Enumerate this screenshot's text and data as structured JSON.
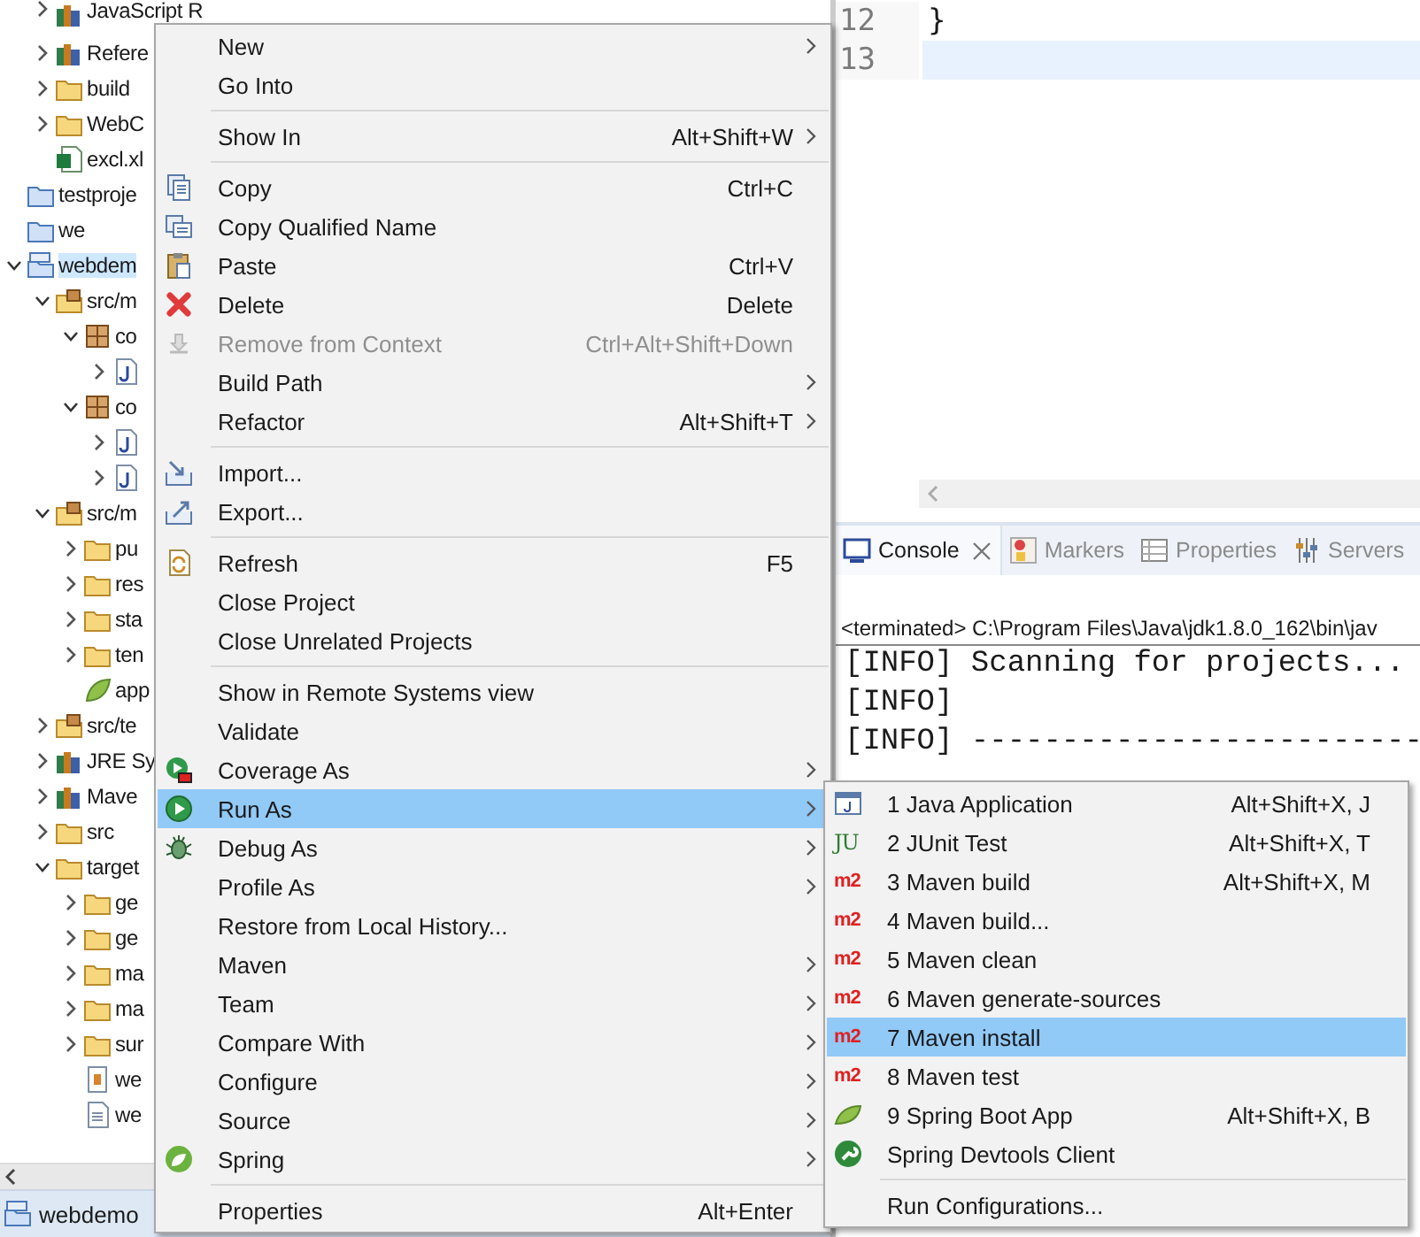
{
  "project_explorer": {
    "continued_items": [
      {
        "label": "JavaScript R",
        "kind": "library",
        "expanded": false,
        "selected": false
      },
      {
        "label": "Refere",
        "kind": "library",
        "expanded": false,
        "selected": false
      },
      {
        "label": "build",
        "kind": "folder",
        "expanded": false,
        "selected": false
      },
      {
        "label": "WebC",
        "kind": "folder",
        "expanded": false,
        "selected": false
      },
      {
        "label": "excl.xl",
        "kind": "excel",
        "selected": false
      }
    ],
    "items": [
      {
        "label": "testproje",
        "kind": "project",
        "selected": false
      },
      {
        "label": "we",
        "kind": "project",
        "selected": false
      },
      {
        "label": "webdem",
        "kind": "maven-project",
        "expanded": true,
        "selected": true,
        "children": [
          {
            "label": "src/m",
            "kind": "source-folder",
            "expanded": true,
            "selected": false,
            "children": [
              {
                "label": "co",
                "kind": "package",
                "expanded": true,
                "selected": false,
                "children": [
                  {
                    "kind": "java-file",
                    "expanded": false,
                    "selected": false
                  }
                ]
              },
              {
                "label": "co",
                "kind": "package",
                "expanded": true,
                "selected": false,
                "children": [
                  {
                    "kind": "java-file",
                    "expanded": false,
                    "selected": false
                  },
                  {
                    "kind": "java-file",
                    "expanded": false,
                    "selected": false
                  }
                ]
              }
            ]
          },
          {
            "label": "src/m",
            "kind": "source-folder",
            "expanded": true,
            "selected": false,
            "children": [
              {
                "label": "pu",
                "kind": "folder",
                "expanded": false,
                "selected": false
              },
              {
                "label": "res",
                "kind": "folder",
                "expanded": false,
                "selected": false
              },
              {
                "label": "sta",
                "kind": "folder",
                "expanded": false,
                "selected": false
              },
              {
                "label": "ten",
                "kind": "folder",
                "expanded": false,
                "selected": false
              },
              {
                "label": "app",
                "kind": "leaf-file",
                "selected": false
              }
            ]
          },
          {
            "label": "src/te",
            "kind": "source-folder",
            "expanded": false,
            "selected": false
          },
          {
            "label": "JRE Sy",
            "kind": "library",
            "expanded": false,
            "selected": false
          },
          {
            "label": "Mave",
            "kind": "library",
            "expanded": false,
            "selected": false
          },
          {
            "label": "src",
            "kind": "folder",
            "expanded": false,
            "selected": false
          },
          {
            "label": "target",
            "kind": "folder",
            "expanded": true,
            "selected": false,
            "children": [
              {
                "label": "ge",
                "kind": "folder",
                "expanded": false,
                "selected": false
              },
              {
                "label": "ge",
                "kind": "folder",
                "expanded": false,
                "selected": false
              },
              {
                "label": "ma",
                "kind": "folder",
                "expanded": false,
                "selected": false
              },
              {
                "label": "ma",
                "kind": "folder",
                "expanded": false,
                "selected": false
              },
              {
                "label": "sur",
                "kind": "folder",
                "expanded": false,
                "selected": false
              },
              {
                "label": "we",
                "kind": "archive-file",
                "selected": false
              },
              {
                "label": "we",
                "kind": "text-file",
                "selected": false
              }
            ]
          }
        ]
      }
    ]
  },
  "status_bar": {
    "project": "webdemo"
  },
  "editor": {
    "lines": [
      {
        "number": "12",
        "code": "}",
        "current": false
      },
      {
        "number": "13",
        "current": true
      }
    ]
  },
  "console": {
    "tabs": [
      {
        "label": "Console",
        "kind": "console",
        "selected": true,
        "closable": true
      },
      {
        "label": "Markers",
        "kind": "markers",
        "selected": false,
        "closable": false
      },
      {
        "label": "Properties",
        "kind": "properties",
        "selected": false,
        "closable": false
      },
      {
        "label": "Servers",
        "kind": "servers",
        "selected": false,
        "closable": false
      }
    ],
    "header": "<terminated> C:\\Program Files\\Java\\jdk1.8.0_162\\bin\\jav",
    "lines": [
      "[INFO] Scanning for projects...",
      "[INFO]",
      "[INFO] -------------------------"
    ]
  },
  "context_menu": {
    "items": [
      {
        "kind": "plain",
        "label": "New",
        "submenu": true,
        "selected": false,
        "disabled": false
      },
      {
        "kind": "plain",
        "label": "Go Into",
        "submenu": false,
        "selected": false,
        "disabled": false
      },
      {
        "kind": "separator"
      },
      {
        "kind": "plain",
        "label": "Show In",
        "shortcut": "Alt+Shift+W",
        "submenu": true,
        "selected": false,
        "disabled": false
      },
      {
        "kind": "separator"
      },
      {
        "kind": "copy",
        "label": "Copy",
        "shortcut": "Ctrl+C",
        "submenu": false,
        "selected": false,
        "disabled": false
      },
      {
        "kind": "copy-name",
        "label": "Copy Qualified Name",
        "submenu": false,
        "selected": false,
        "disabled": false
      },
      {
        "kind": "paste",
        "label": "Paste",
        "shortcut": "Ctrl+V",
        "submenu": false,
        "selected": false,
        "disabled": false
      },
      {
        "kind": "delete",
        "label": "Delete",
        "shortcut": "Delete",
        "submenu": false,
        "selected": false,
        "disabled": false
      },
      {
        "kind": "remove",
        "label": "Remove from Context",
        "shortcut": "Ctrl+Alt+Shift+Down",
        "submenu": false,
        "selected": false,
        "disabled": true
      },
      {
        "kind": "plain",
        "label": "Build Path",
        "submenu": true,
        "selected": false,
        "disabled": false
      },
      {
        "kind": "plain",
        "label": "Refactor",
        "shortcut": "Alt+Shift+T",
        "submenu": true,
        "selected": false,
        "disabled": false
      },
      {
        "kind": "separator"
      },
      {
        "kind": "import",
        "label": "Import...",
        "submenu": false,
        "selected": false,
        "disabled": false
      },
      {
        "kind": "export",
        "label": "Export...",
        "submenu": false,
        "selected": false,
        "disabled": false
      },
      {
        "kind": "separator"
      },
      {
        "kind": "refresh",
        "label": "Refresh",
        "shortcut": "F5",
        "submenu": false,
        "selected": false,
        "disabled": false
      },
      {
        "kind": "plain",
        "label": "Close Project",
        "submenu": false,
        "selected": false,
        "disabled": false
      },
      {
        "kind": "plain",
        "label": "Close Unrelated Projects",
        "submenu": false,
        "selected": false,
        "disabled": false
      },
      {
        "kind": "separator"
      },
      {
        "kind": "plain",
        "label": "Show in Remote Systems view",
        "submenu": false,
        "selected": false,
        "disabled": false
      },
      {
        "kind": "plain",
        "label": "Validate",
        "submenu": false,
        "selected": false,
        "disabled": false
      },
      {
        "kind": "coverage",
        "label": "Coverage As",
        "submenu": true,
        "selected": false,
        "disabled": false
      },
      {
        "kind": "run",
        "label": "Run As",
        "submenu": true,
        "selected": true,
        "disabled": false
      },
      {
        "kind": "debug",
        "label": "Debug As",
        "submenu": true,
        "selected": false,
        "disabled": false
      },
      {
        "kind": "plain",
        "label": "Profile As",
        "submenu": true,
        "selected": false,
        "disabled": false
      },
      {
        "kind": "plain",
        "label": "Restore from Local History...",
        "submenu": false,
        "selected": false,
        "disabled": false
      },
      {
        "kind": "plain",
        "label": "Maven",
        "submenu": true,
        "selected": false,
        "disabled": false
      },
      {
        "kind": "plain",
        "label": "Team",
        "submenu": true,
        "selected": false,
        "disabled": false
      },
      {
        "kind": "plain",
        "label": "Compare With",
        "submenu": true,
        "selected": false,
        "disabled": false
      },
      {
        "kind": "plain",
        "label": "Configure",
        "submenu": true,
        "selected": false,
        "disabled": false
      },
      {
        "kind": "plain",
        "label": "Source",
        "submenu": true,
        "selected": false,
        "disabled": false
      },
      {
        "kind": "spring",
        "label": "Spring",
        "submenu": true,
        "selected": false,
        "disabled": false
      },
      {
        "kind": "separator"
      },
      {
        "kind": "plain",
        "label": "Properties",
        "shortcut": "Alt+Enter",
        "submenu": false,
        "selected": false,
        "disabled": false
      }
    ]
  },
  "run_as_submenu": {
    "items": [
      {
        "kind": "java-app",
        "label": "1 Java Application",
        "shortcut": "Alt+Shift+X, J",
        "submenu": false,
        "selected": false,
        "disabled": false
      },
      {
        "kind": "junit",
        "icon_text": "JU",
        "label": "2 JUnit Test",
        "shortcut": "Alt+Shift+X, T",
        "submenu": false,
        "selected": false,
        "disabled": false
      },
      {
        "kind": "maven",
        "icon_text": "m2",
        "label": "3 Maven build",
        "shortcut": "Alt+Shift+X, M",
        "submenu": false,
        "selected": false,
        "disabled": false
      },
      {
        "kind": "maven",
        "icon_text": "m2",
        "label": "4 Maven build...",
        "submenu": false,
        "selected": false,
        "disabled": false
      },
      {
        "kind": "maven",
        "icon_text": "m2",
        "label": "5 Maven clean",
        "submenu": false,
        "selected": false,
        "disabled": false
      },
      {
        "kind": "maven",
        "icon_text": "m2",
        "label": "6 Maven generate-sources",
        "submenu": false,
        "selected": false,
        "disabled": false
      },
      {
        "kind": "maven",
        "icon_text": "m2",
        "label": "7 Maven install",
        "submenu": false,
        "selected": true,
        "disabled": false
      },
      {
        "kind": "maven",
        "icon_text": "m2",
        "label": "8 Maven test",
        "submenu": false,
        "selected": false,
        "disabled": false
      },
      {
        "kind": "spring-boot",
        "label": "9 Spring Boot App",
        "shortcut": "Alt+Shift+X, B",
        "submenu": false,
        "selected": false,
        "disabled": false
      },
      {
        "kind": "devtools",
        "label": "Spring Devtools Client",
        "submenu": false,
        "selected": false,
        "disabled": false
      },
      {
        "kind": "separator"
      },
      {
        "kind": "plain",
        "label": "Run Configurations...",
        "submenu": false,
        "selected": false,
        "disabled": false
      }
    ]
  }
}
